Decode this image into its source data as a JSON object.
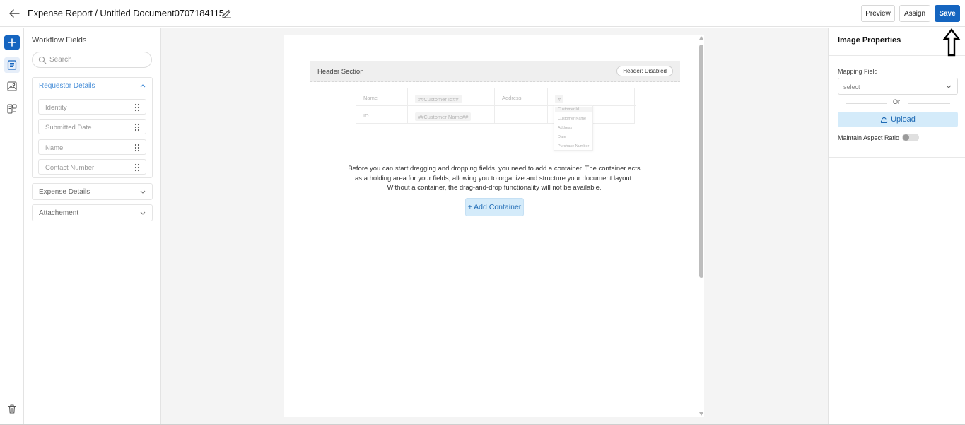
{
  "header": {
    "title": "Expense Report / Untitled Document0707184115",
    "preview_label": "Preview",
    "assign_label": "Assign",
    "save_label": "Save"
  },
  "fields_panel": {
    "title": "Workflow Fields",
    "search_placeholder": "Search",
    "groups": [
      {
        "label": "Requestor Details",
        "expanded": true,
        "items": [
          "Identity",
          "Submitted Date",
          "Name",
          "Contact Number"
        ]
      },
      {
        "label": "Expense Details",
        "expanded": false
      },
      {
        "label": "Attachement",
        "expanded": false
      }
    ]
  },
  "canvas": {
    "header_section_label": "Header Section",
    "header_badge": "Header: Disabled",
    "preview": {
      "row1": [
        "Name",
        "##Customer Id##",
        "Address",
        "#"
      ],
      "row2": [
        "ID",
        "##Customer Name##"
      ],
      "dropdown": [
        "Customer Id",
        "Customer Name",
        "Address",
        "Date",
        "Purchase Number"
      ]
    },
    "info_text": "Before you can start dragging and dropping fields, you need to add a container. The container acts as a holding area for your fields, allowing you to organize and structure your document layout. Without a container, the drag-and-drop functionality will not be available.",
    "add_container_label": "+ Add Container"
  },
  "properties": {
    "title": "Image Properties",
    "mapping_label": "Mapping Field",
    "select_value": "select",
    "or_text": "Or",
    "upload_label": "Upload",
    "aspect_label": "Maintain Aspect Ratio",
    "aspect_enabled": false
  },
  "colors": {
    "primary": "#1565c0",
    "accent_light": "#d4ebfa",
    "link": "#4a90d9"
  }
}
